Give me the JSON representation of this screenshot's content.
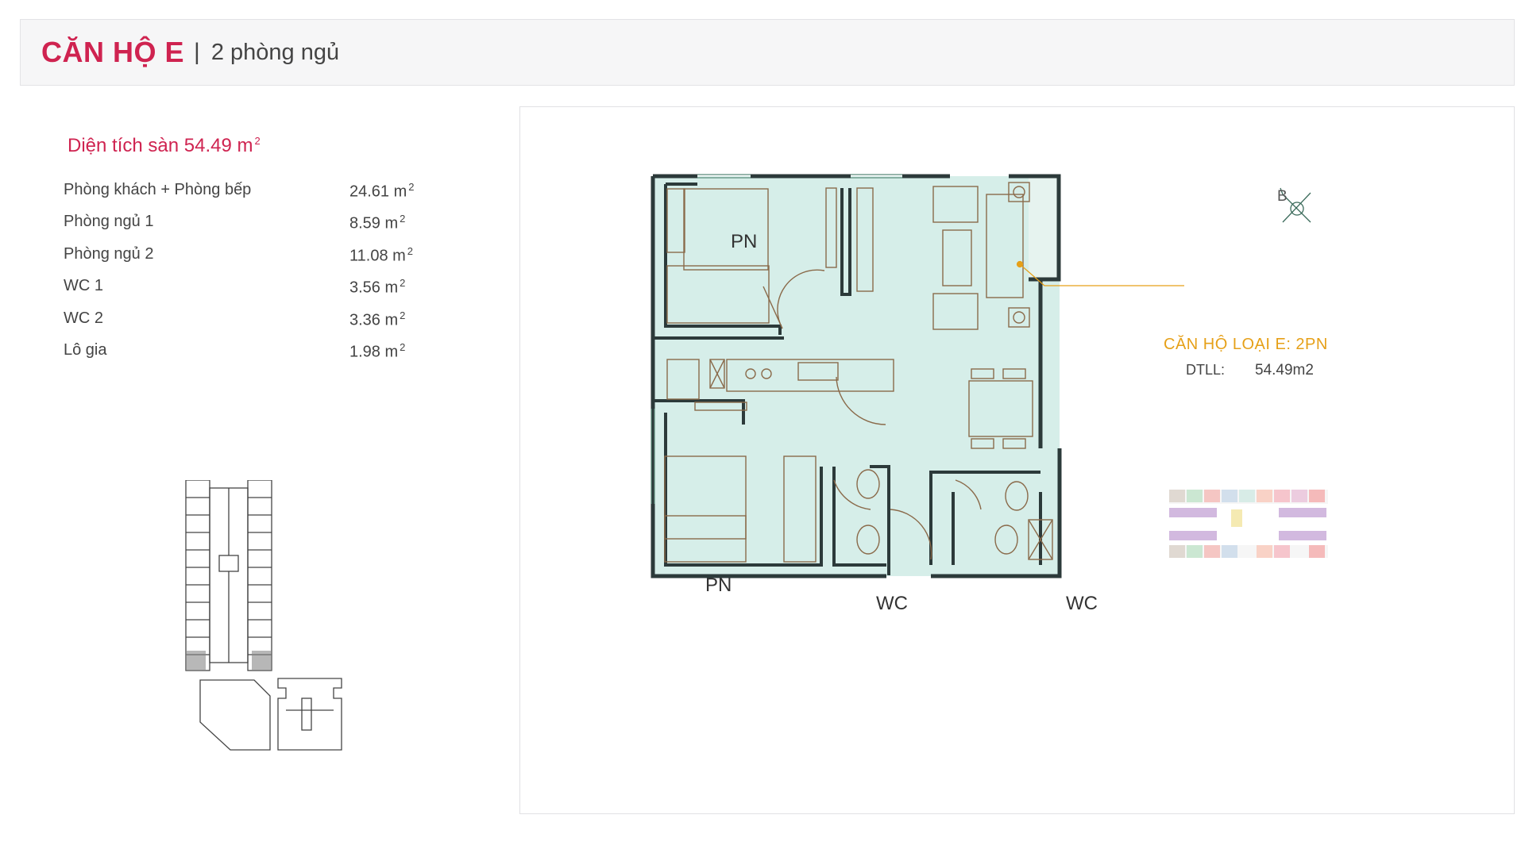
{
  "header": {
    "title": "CĂN HỘ E",
    "separator": "|",
    "subtitle": "2 phòng ngủ"
  },
  "summary": {
    "label": "Diện tích sàn 54.49 m",
    "unit_sup": "2"
  },
  "rooms": [
    {
      "name": "Phòng khách + Phòng bếp",
      "value": "24.61 m",
      "sup": "2"
    },
    {
      "name": "Phòng ngủ 1",
      "value": "8.59 m",
      "sup": "2"
    },
    {
      "name": "Phòng ngủ 2",
      "value": "11.08 m",
      "sup": "2"
    },
    {
      "name": "WC 1",
      "value": "3.56 m",
      "sup": "2"
    },
    {
      "name": "WC 2",
      "value": "3.36 m",
      "sup": "2"
    },
    {
      "name": "Lô gia",
      "value": "1.98 m",
      "sup": "2"
    }
  ],
  "plan": {
    "room_labels": {
      "bedroom_1": "PN",
      "bedroom_2": "PN",
      "wc_1": "WC",
      "wc_2": "WC"
    },
    "apartment_type": "CĂN HỘ LOẠI E: 2PN",
    "dtll_label": "DTLL:",
    "dtll_value": "54.49m2",
    "compass_letter": "B",
    "floor_color": "#d6eee9",
    "wall_color": "#2c3a3a",
    "furniture_color": "#8a6a4a"
  },
  "colors": {
    "accent": "#cf2350",
    "annotation": "#e6a018"
  }
}
